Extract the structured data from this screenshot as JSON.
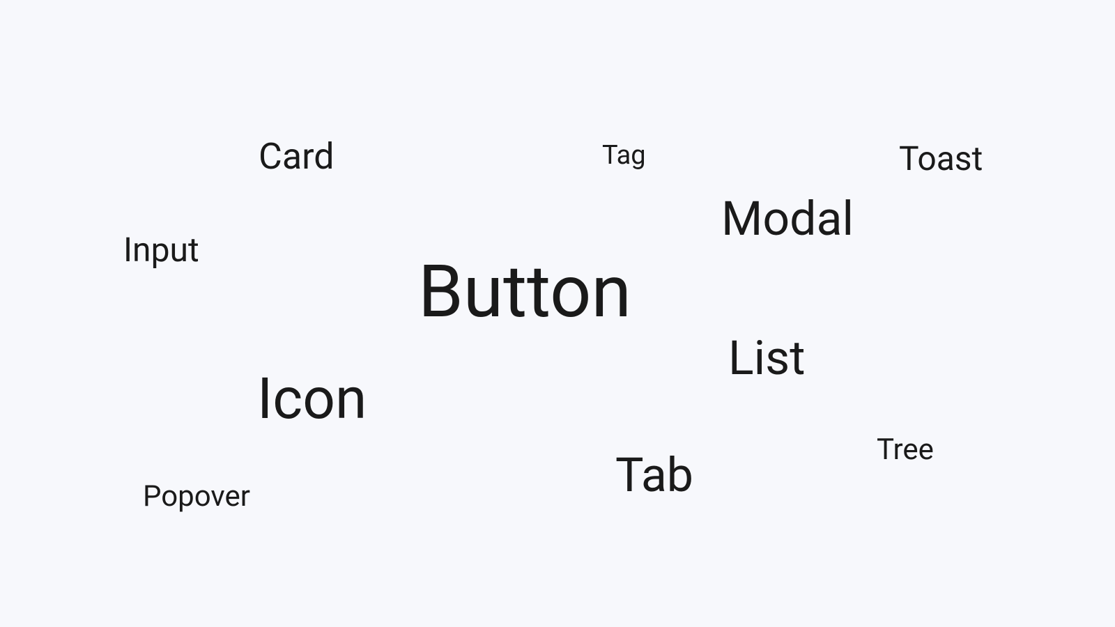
{
  "words": {
    "card": "Card",
    "tag": "Tag",
    "toast": "Toast",
    "input": "Input",
    "modal": "Modal",
    "button": "Button",
    "list": "List",
    "icon": "Icon",
    "tab": "Tab",
    "tree": "Tree",
    "popover": "Popover"
  }
}
